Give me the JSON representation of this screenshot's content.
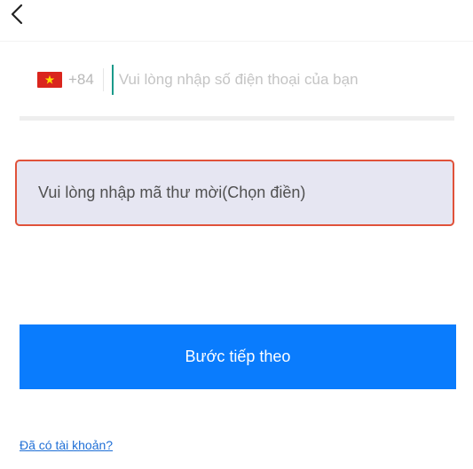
{
  "header": {
    "back_icon": "chevron-left-icon"
  },
  "phone": {
    "flag_icon": "vietnam-flag-icon",
    "country_code": "+84",
    "placeholder": "Vui lòng nhập số điện thoại của bạn",
    "value": ""
  },
  "invite": {
    "placeholder": "Vui lòng nhập mã thư mời(Chọn điền)",
    "value": ""
  },
  "actions": {
    "next_label": "Bước tiếp theo",
    "login_link": "Đã có tài khoản?"
  },
  "colors": {
    "primary": "#0a7cfd",
    "highlight_border": "#e0523a",
    "invite_bg": "#e6e6f2",
    "link": "#1f6fd6"
  }
}
